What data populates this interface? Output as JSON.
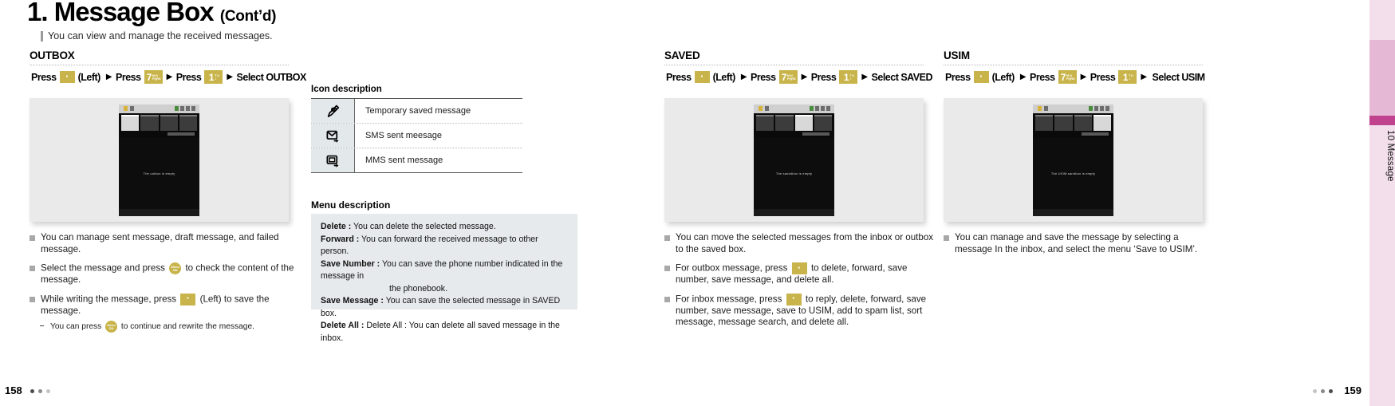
{
  "header": {
    "number": "1.",
    "title": "Message Box",
    "cont": "(Cont’d)",
    "subtitle": "You can view and manage the received messages."
  },
  "sidetab": {
    "label": "10  Message"
  },
  "keys": {
    "soft_left": "·",
    "num7_main": "7",
    "num7_sub": "M N\n PQRS",
    "num1_main": "1",
    "num1_sub": "T U\n  ·",
    "ok": "OK"
  },
  "sections": [
    {
      "id": "outbox",
      "heading": "OUTBOX",
      "steps": {
        "press1": "Press",
        "left": "(Left)",
        "press2": "Press",
        "press3": "Press",
        "select": "Select OUTBOX"
      },
      "phone_caption": "The outbox  is empty",
      "bullets": [
        {
          "type": "square",
          "text": "You can manage sent message, draft message, and failed message."
        },
        {
          "type": "square",
          "pre": "Select the message and press",
          "key": "ok",
          "post": "to check the content of the message."
        },
        {
          "type": "square",
          "pre": "While writing the message, press",
          "key": "soft",
          "post": "(Left) to save the message."
        },
        {
          "type": "dash",
          "pre": "You can press",
          "key": "ok",
          "post": "to continue and rewrite the message."
        }
      ]
    },
    {
      "id": "saved",
      "heading": "SAVED",
      "steps": {
        "press1": "Press",
        "left": "(Left)",
        "press2": "Press",
        "press3": "Press",
        "select": "Select SAVED"
      },
      "phone_caption": "The savedbox  is empty",
      "bullets": [
        {
          "type": "square",
          "text": "You can move the selected messages from the inbox or outbox to the saved box."
        },
        {
          "type": "square",
          "pre": "For outbox message, press",
          "key": "soft",
          "post": "to delete, forward, save number, save message, and delete all."
        },
        {
          "type": "square",
          "pre": "For inbox message, press",
          "key": "soft",
          "post": "to reply, delete, forward, save number, save message, save to USIM, add to spam list, sort message, message search, and delete all."
        }
      ]
    },
    {
      "id": "usim",
      "heading": "USIM",
      "steps": {
        "press1": "Press",
        "left": "(Left)",
        "press2": "Press",
        "press3": "Press",
        "select": "Select USIM"
      },
      "phone_caption": "The USIM sandbox  is empty",
      "bullets": [
        {
          "type": "square",
          "text": "You can manage and save the message by selecting a message In the inbox, and select the menu ‘Save to USIM’."
        }
      ]
    }
  ],
  "icon_description": {
    "title": "Icon description",
    "rows": [
      {
        "glyph": "✎",
        "icon_name": "pencil-note-icon",
        "text": "Temporary saved message"
      },
      {
        "glyph": "✉",
        "icon_name": "sms-sent-icon",
        "text": "SMS sent meesage"
      },
      {
        "glyph": "✉",
        "icon_name": "mms-sent-icon",
        "text": "MMS sent message"
      }
    ]
  },
  "menu_description": {
    "title": "Menu description",
    "items": [
      {
        "label": "Delete :",
        "text": "You can delete the selected message."
      },
      {
        "label": "Forward :",
        "text": "You can forward the received message to other person."
      },
      {
        "label": "Save Number :",
        "text": "You can save the phone number indicated in the message in",
        "cont": "the phonebook."
      },
      {
        "label": "Save Message :",
        "text": "You can save the selected message in SAVED box."
      },
      {
        "label": "Delete All :",
        "text": "Delete All : You can delete all saved message in the inbox."
      }
    ]
  },
  "footer": {
    "page_left": "158",
    "page_right": "159"
  },
  "colors": {
    "key": "#c8b44a",
    "tab": "#e5b9d6",
    "tab_accent": "#c0418d",
    "menu_bg": "#e6eaec"
  }
}
